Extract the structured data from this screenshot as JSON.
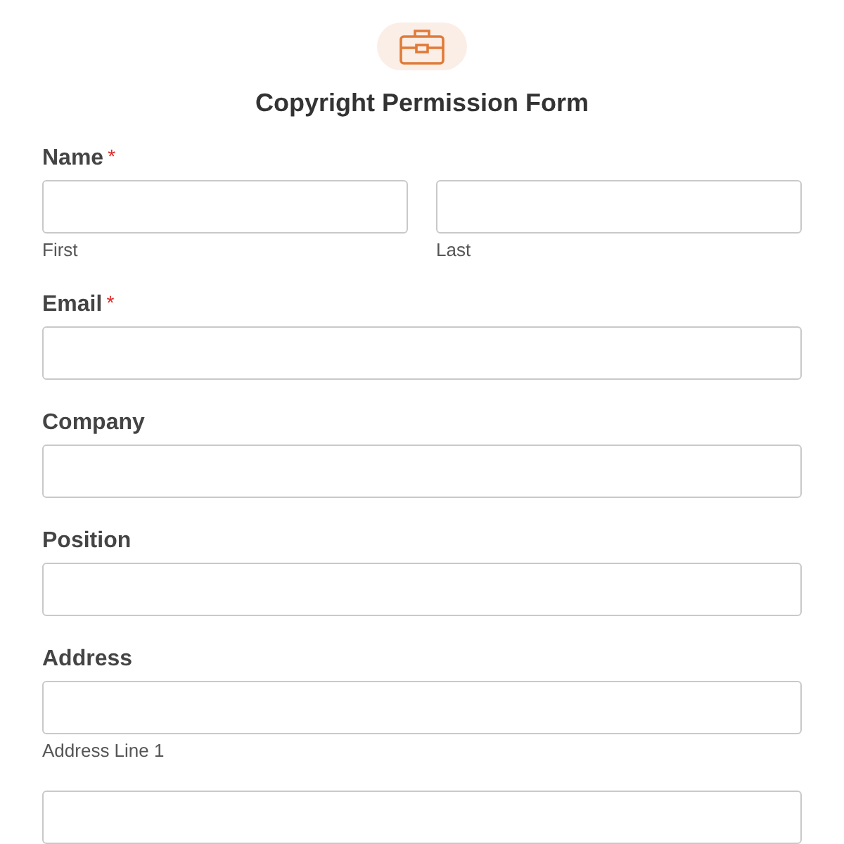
{
  "form": {
    "title": "Copyright Permission Form"
  },
  "fields": [
    {
      "kind": "split",
      "label": "Name",
      "required_mark": "*",
      "inputs": [
        {
          "sublabel": "First"
        },
        {
          "sublabel": "Last"
        }
      ]
    },
    {
      "kind": "single",
      "label": "Email",
      "required_mark": "*"
    },
    {
      "kind": "single",
      "label": "Company"
    },
    {
      "kind": "single",
      "label": "Position"
    },
    {
      "kind": "single",
      "label": "Address",
      "sublabel": "Address Line 1"
    },
    {
      "kind": "single"
    }
  ]
}
